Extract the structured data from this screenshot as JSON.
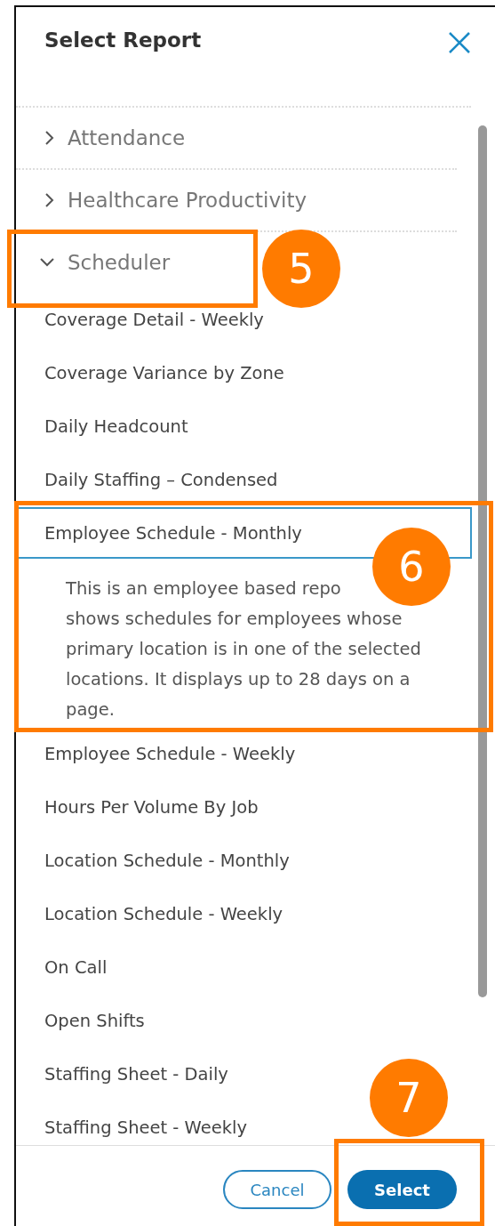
{
  "dialog": {
    "title": "Select Report"
  },
  "categories": [
    {
      "label": "Attendance",
      "expanded": false
    },
    {
      "label": "Healthcare Productivity",
      "expanded": false
    },
    {
      "label": "Scheduler",
      "expanded": true,
      "reports": [
        {
          "label": "Coverage Detail - Weekly",
          "selected": false
        },
        {
          "label": "Coverage Variance by Zone",
          "selected": false
        },
        {
          "label": "Daily Headcount",
          "selected": false
        },
        {
          "label": "Daily Staffing – Condensed",
          "selected": false
        },
        {
          "label": "Employee Schedule - Monthly",
          "selected": true,
          "description": [
            "This is an employee based repo",
            "shows schedules for employees whose primary location is in one of the selected locations. It displays up to 28 days on a page."
          ]
        },
        {
          "label": "Employee Schedule - Weekly",
          "selected": false
        },
        {
          "label": "Hours Per Volume By Job",
          "selected": false
        },
        {
          "label": "Location Schedule - Monthly",
          "selected": false
        },
        {
          "label": "Location Schedule - Weekly",
          "selected": false
        },
        {
          "label": "On Call",
          "selected": false
        },
        {
          "label": "Open Shifts",
          "selected": false
        },
        {
          "label": "Staffing Sheet - Daily",
          "selected": false
        },
        {
          "label": "Staffing Sheet - Weekly",
          "selected": false
        }
      ]
    }
  ],
  "buttons": [
    {
      "label": "Cancel",
      "kind": "secondary"
    },
    {
      "label": "Select",
      "kind": "primary"
    }
  ],
  "callouts": [
    {
      "number": "5"
    },
    {
      "number": "6"
    },
    {
      "number": "7"
    }
  ]
}
